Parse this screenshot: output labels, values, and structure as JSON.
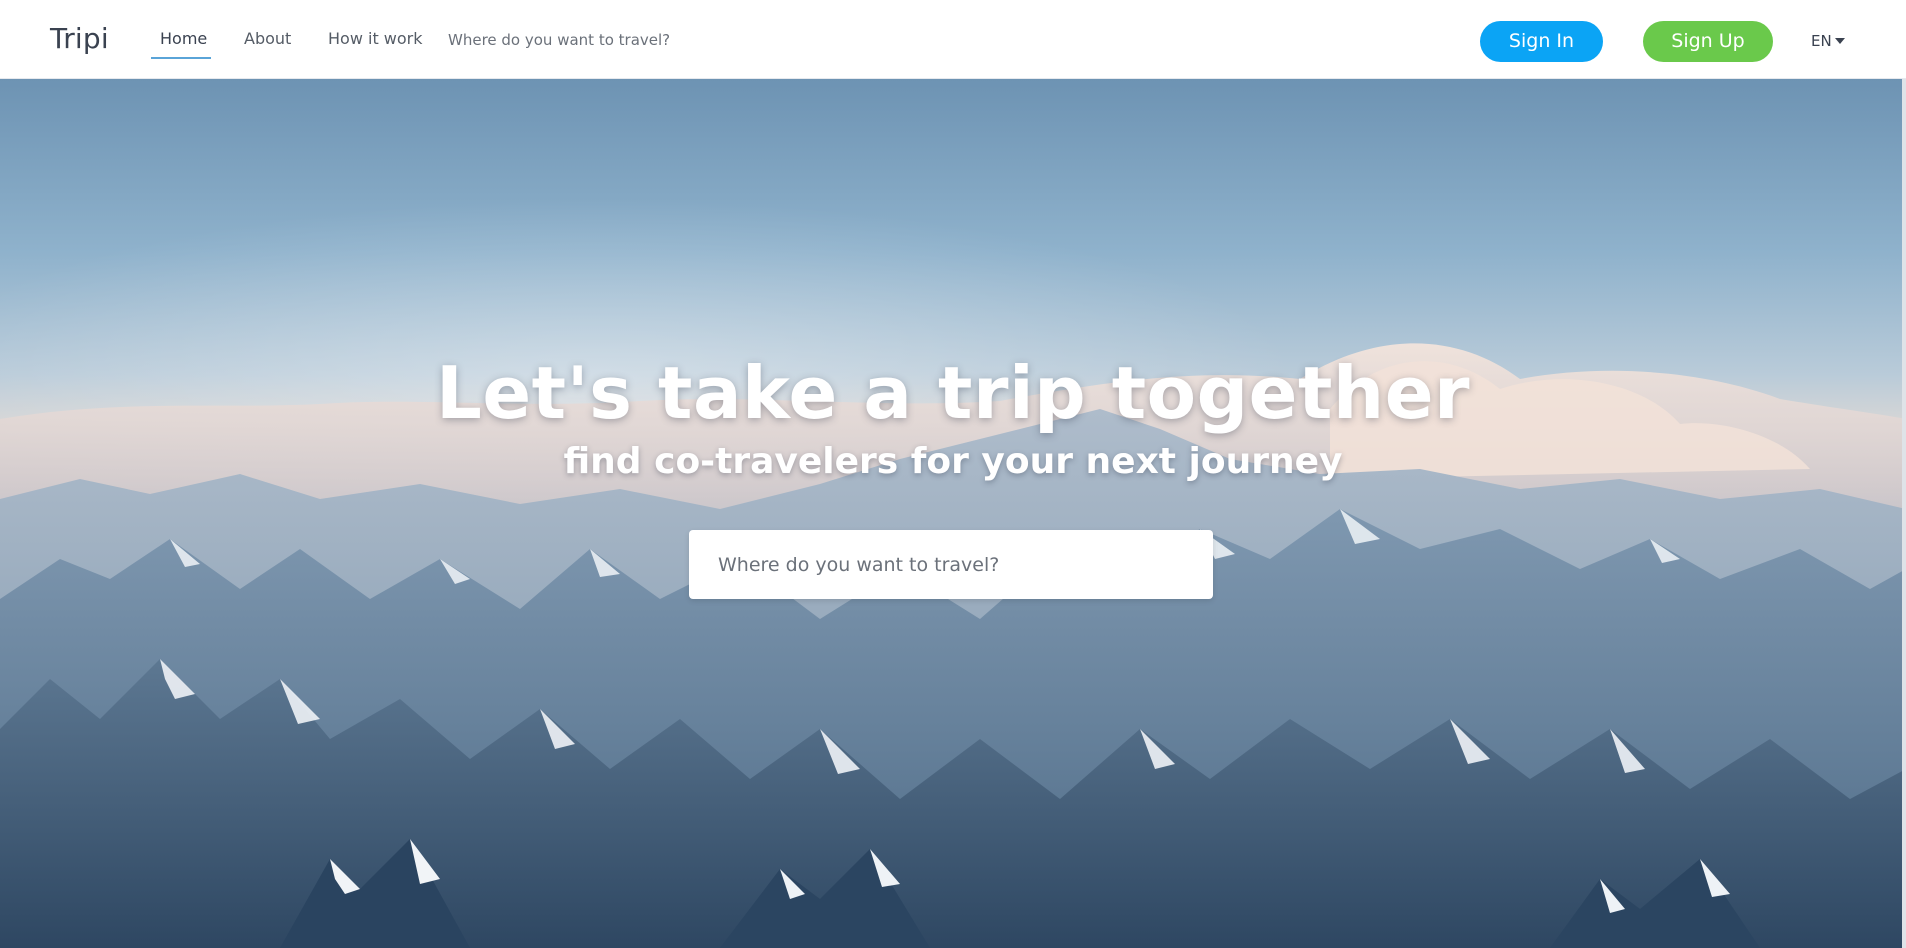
{
  "nav": {
    "brand": "Tripi",
    "links": [
      {
        "label": "Home",
        "active": true
      },
      {
        "label": "About",
        "active": false
      },
      {
        "label": "How it work",
        "active": false
      }
    ],
    "search_placeholder": "Where do you want to travel?",
    "sign_in_label": "Sign In",
    "sign_up_label": "Sign Up",
    "language": "EN"
  },
  "hero": {
    "title": "Let's take a trip together",
    "subtitle": "find co-travelers for your next journey",
    "search_placeholder": "Where do you want to travel?",
    "background": "aerial-snowy-mountains-above-clouds"
  },
  "colors": {
    "sign_in": "#0ba4f5",
    "sign_up": "#6ac94b",
    "active_underline": "#5aa4d8",
    "text_dark": "#3a4250"
  },
  "icons": {
    "language_dropdown": "caret-down-icon"
  }
}
